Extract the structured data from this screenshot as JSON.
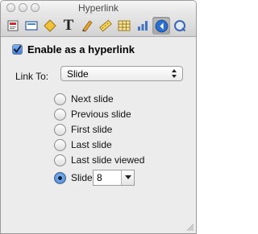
{
  "window": {
    "title": "Hyperlink"
  },
  "toolbar": {
    "buttons": [
      {
        "icon": "document-inspector-icon"
      },
      {
        "icon": "slide-inspector-icon"
      },
      {
        "icon": "build-inspector-icon"
      },
      {
        "icon": "text-inspector-icon"
      },
      {
        "icon": "graphic-inspector-icon"
      },
      {
        "icon": "metrics-inspector-icon"
      },
      {
        "icon": "table-inspector-icon"
      },
      {
        "icon": "chart-inspector-icon"
      },
      {
        "icon": "hyperlink-inspector-icon",
        "active": true
      },
      {
        "icon": "quicktime-inspector-icon"
      }
    ],
    "text_icon_glyph": "T"
  },
  "hyperlink": {
    "enable_label": "Enable as a hyperlink",
    "enabled": true,
    "link_to_label": "Link To:",
    "link_to_value": "Slide",
    "options": [
      {
        "label": "Next slide",
        "selected": false
      },
      {
        "label": "Previous slide",
        "selected": false
      },
      {
        "label": "First slide",
        "selected": false
      },
      {
        "label": "Last slide",
        "selected": false
      },
      {
        "label": "Last slide viewed",
        "selected": false
      },
      {
        "label": "Slide",
        "selected": true
      }
    ],
    "slide_number": "8"
  },
  "colors": {
    "accent": "#3d7fd9",
    "active_icon": "#2a6fd0"
  }
}
